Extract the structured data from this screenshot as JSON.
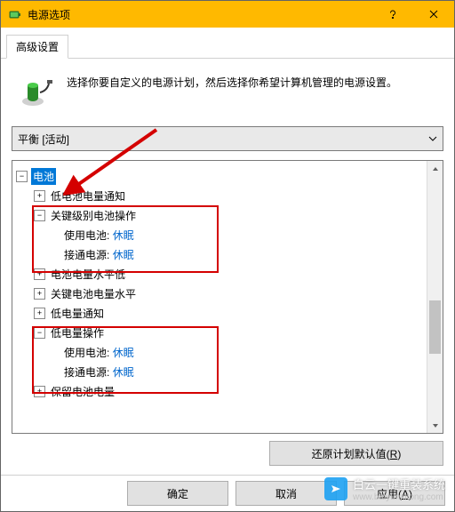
{
  "window": {
    "title": "电源选项",
    "help_tooltip": "帮助",
    "close_tooltip": "关闭"
  },
  "tab": {
    "label": "高级设置"
  },
  "intro": {
    "text": "选择你要自定义的电源计划，然后选择你希望计算机管理的电源设置。"
  },
  "plan_combo": {
    "value": "平衡 [活动]"
  },
  "tree": {
    "root": {
      "label": "电池"
    },
    "n_low_notify": {
      "label": "低电池电量通知"
    },
    "n_critical_action": {
      "label": "关键级别电池操作",
      "on_battery_k": "使用电池:",
      "on_battery_v": "休眠",
      "plugged_k": "接通电源:",
      "plugged_v": "休眠"
    },
    "n_battery_low_level": {
      "label": "电池电量水平低"
    },
    "n_critical_level": {
      "label": "关键电池电量水平"
    },
    "n_low_notify2": {
      "label": "低电量通知"
    },
    "n_low_action": {
      "label": "低电量操作",
      "on_battery_k": "使用电池:",
      "on_battery_v": "休眠",
      "plugged_k": "接通电源:",
      "plugged_v": "休眠"
    },
    "n_reserve": {
      "label": "保留电池电量"
    }
  },
  "buttons": {
    "restore_defaults": "还原计划默认值(R)",
    "ok": "确定",
    "cancel": "取消",
    "apply": "应用(A)"
  },
  "watermark": {
    "text": "白云一键重装系统",
    "url": "www.baiyunxitong.com"
  },
  "icons": {
    "battery": "battery-icon",
    "help": "help-icon",
    "close": "close-icon",
    "dropdown": "chevron-down-icon",
    "scroll_up": "triangle-up-icon",
    "scroll_down": "triangle-down-icon"
  },
  "annotations": {
    "arrow_color": "#d40000",
    "box_color": "#d40000"
  }
}
